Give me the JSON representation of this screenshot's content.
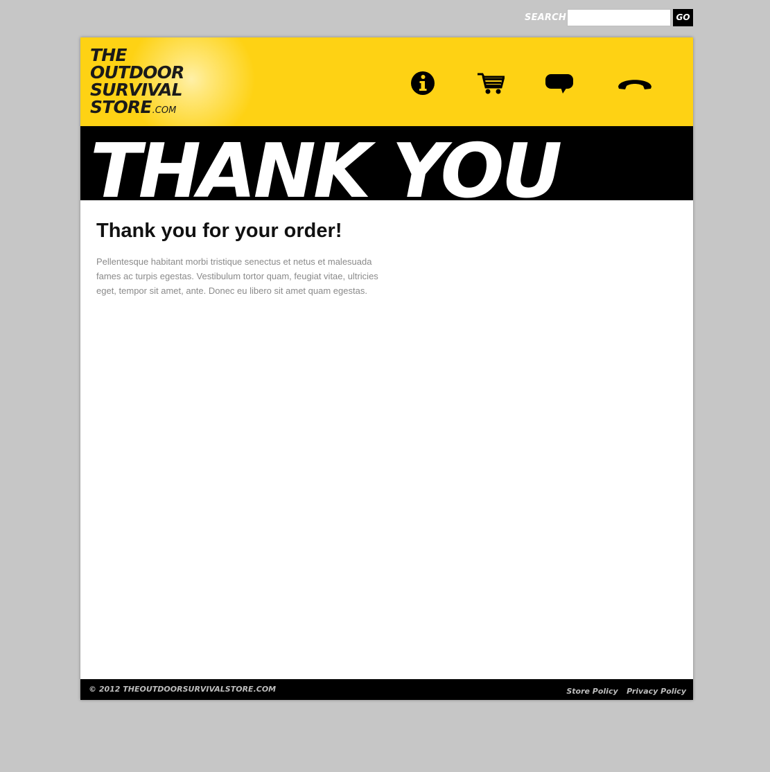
{
  "search": {
    "label": "SEARCH",
    "value": "",
    "placeholder": "",
    "button_label": "GO"
  },
  "header": {
    "logo": {
      "line1": "THE",
      "line2": "OUTDOOR",
      "line3": "SURVIVAL",
      "line4": "STORE",
      "suffix": ".COM"
    },
    "nav_icons": [
      "info-icon",
      "cart-icon",
      "chat-icon",
      "phone-icon"
    ],
    "brand_color": "#fed214"
  },
  "banner": {
    "text": "THANK YOU"
  },
  "content": {
    "title": "Thank you for your order!",
    "body": "Pellentesque habitant morbi tristique senectus et netus et malesuada fames ac turpis egestas. Vestibulum tortor quam, feugiat vitae, ultricies eget, tempor sit amet, ante. Donec eu libero sit amet quam egestas."
  },
  "footer": {
    "copyright": "© 2012 THEOUTDOORSURVIVALSTORE.COM",
    "links": [
      "Store Policy",
      "Privacy Policy"
    ]
  }
}
